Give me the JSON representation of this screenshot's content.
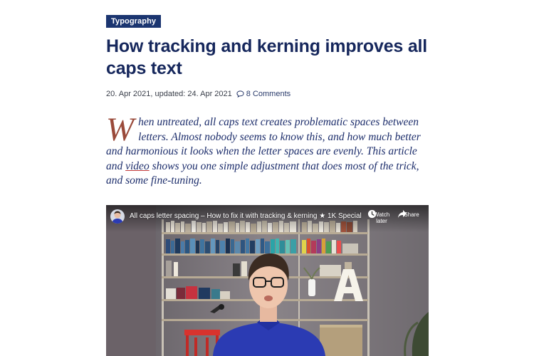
{
  "article": {
    "category": "Typography",
    "title": "How tracking and kerning improves all caps text",
    "meta": {
      "date": "20. Apr 2021, updated: 24. Apr 2021",
      "comments": "8 Comments"
    },
    "lead": {
      "dropcap": "W",
      "before_link": "hen untreated, all caps text creates problematic spaces between letters. Almost nobody seems to know this, and how much better and harmonious it looks when the letter spaces are evenly. This article and ",
      "link": "video",
      "after_link": " shows you one simple adjustment that does most of the trick, and some fine-tuning."
    }
  },
  "video": {
    "title": "All caps letter spacing – How to fix it with tracking & kerning ★ 1K Special",
    "watch_later": "Watch later",
    "share": "Share",
    "sign_letter": "A"
  },
  "colors": {
    "accent": "#1b3570",
    "title": "#16275c",
    "dropcap": "#9a4a3a",
    "link_underline": "#c33a3a"
  },
  "icons": [
    "comment-icon",
    "clock-icon",
    "share-icon"
  ]
}
